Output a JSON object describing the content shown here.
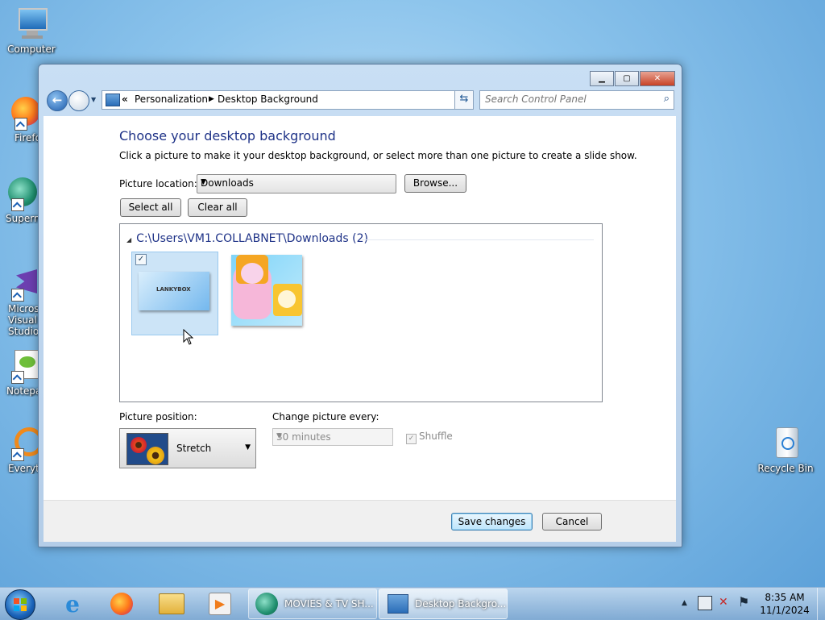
{
  "desktop": {
    "icons": [
      {
        "label": "Computer"
      },
      {
        "label": "Firefox"
      },
      {
        "label": "Supermium"
      },
      {
        "label": "Microsoft Visual Studio"
      },
      {
        "label": "Notepad++"
      },
      {
        "label": "Everything"
      },
      {
        "label": "Recycle Bin"
      }
    ]
  },
  "window": {
    "address": {
      "prefix": "«",
      "segments": [
        "Personalization",
        "Desktop Background"
      ]
    },
    "search_placeholder": "Search Control Panel",
    "heading": "Choose your desktop background",
    "description": "Click a picture to make it your desktop background, or select more than one picture to create a slide show.",
    "picture_location_label": "Picture location:",
    "picture_location_value": "Downloads",
    "browse_label": "Browse...",
    "select_all_label": "Select all",
    "clear_all_label": "Clear all",
    "group_header": "C:\\Users\\VM1.COLLABNET\\Downloads (2)",
    "thumbnails": [
      {
        "name": "lankybox-banner",
        "checked": true,
        "logo_text": "LANKYBOX"
      },
      {
        "name": "lankybox-characters",
        "checked": false
      }
    ],
    "picture_position_label": "Picture position:",
    "picture_position_value": "Stretch",
    "change_every_label": "Change picture every:",
    "change_every_value": "30 minutes",
    "shuffle_label": "Shuffle",
    "shuffle_checked": true,
    "save_label": "Save changes",
    "cancel_label": "Cancel"
  },
  "taskbar": {
    "tasks": [
      {
        "label": "MOVIES & TV SH..."
      },
      {
        "label": "Desktop Backgro..."
      }
    ],
    "clock_time": "8:35 AM",
    "clock_date": "11/1/2024"
  },
  "colors": {
    "heading": "#1e3287",
    "selection": "#cce4f7"
  }
}
